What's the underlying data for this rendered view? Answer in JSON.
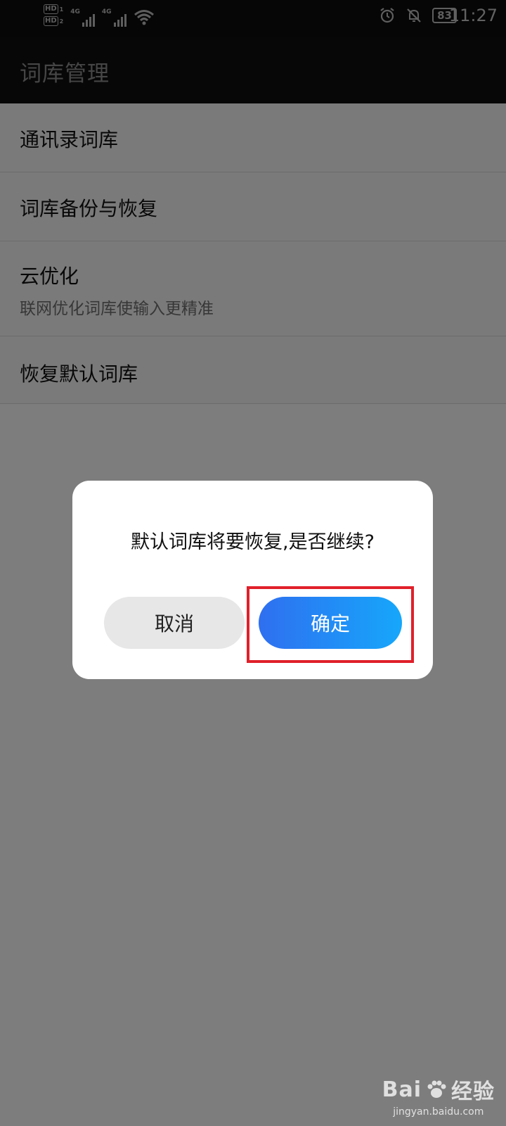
{
  "status_bar": {
    "hd1": "HD",
    "hd1_num": "1",
    "hd2": "HD",
    "hd2_num": "2",
    "net1": "4G",
    "net2": "4G",
    "battery": "83",
    "time": "11:27"
  },
  "app_bar": {
    "title": "词库管理"
  },
  "list": {
    "items": [
      {
        "title": "通讯录词库"
      },
      {
        "title": "词库备份与恢复"
      },
      {
        "title": "云优化",
        "subtitle": "联网优化词库使输入更精准"
      },
      {
        "title": "恢复默认词库"
      }
    ]
  },
  "dialog": {
    "message": "默认词库将要恢复,是否继续?",
    "cancel_label": "取消",
    "ok_label": "确定"
  },
  "colors": {
    "accent_start": "#2f6ff0",
    "accent_end": "#16a7fb",
    "highlight": "#e0202a"
  },
  "watermark": {
    "main": "Bai",
    "main_suffix": "经验",
    "sub": "jingyan.baidu.com"
  }
}
